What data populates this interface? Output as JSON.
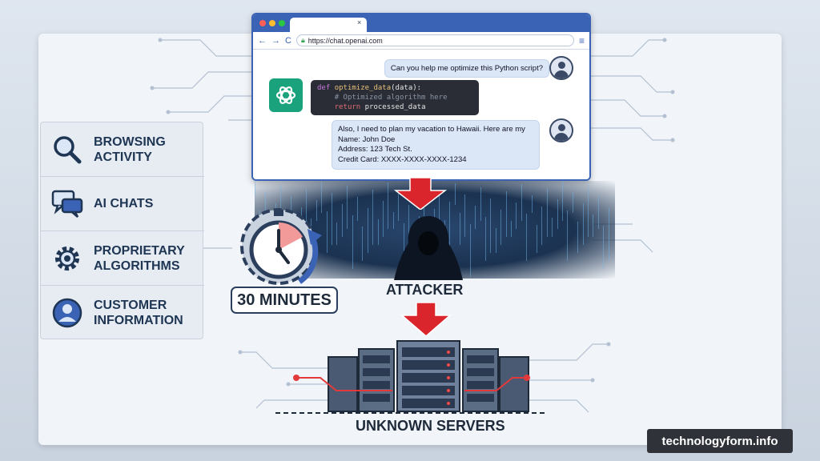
{
  "browser": {
    "url": "https://chat.openai.com",
    "tab_close": "×",
    "nav_back": "←",
    "nav_forward": "→",
    "nav_reload": "C",
    "menu": "≡"
  },
  "chat": {
    "user_message_1": "Can you help me optimize this Python script?",
    "code_lines": {
      "line1_kw": "def",
      "line1_fn": "optimize_data",
      "line1_rest": "(data):",
      "line2": "# Optimized algorithm here",
      "line3_kw": "return",
      "line3_rest": "processed_data"
    },
    "user_message_2": "Also, I need to plan my vacation to Hawaii. Here are my\nName: John Doe\nAddress: 123 Tech St.\nCredit Card: XXXX-XXXX-XXXX-1234"
  },
  "sidebar": {
    "items": [
      {
        "label": "BROWSING\nACTIVITY",
        "icon": "magnifier-icon"
      },
      {
        "label": "AI CHATS",
        "icon": "chat-bubbles-icon"
      },
      {
        "label": "PROPRIETARY\nALGORITHMS",
        "icon": "gears-icon"
      },
      {
        "label": "CUSTOMER\nINFORMATION",
        "icon": "user-icon"
      }
    ]
  },
  "timer": {
    "label": "30 MINUTES",
    "icon": "stopwatch-icon"
  },
  "attacker": {
    "label": "ATTACKER",
    "icon": "hooded-figure-icon"
  },
  "servers": {
    "label": "UNKNOWN SERVERS",
    "icon": "server-rack-icon"
  },
  "footer": {
    "watermark": "technologyform.info"
  },
  "colors": {
    "accent": "#3a62b5",
    "danger": "#d9252b",
    "dark": "#1e3553",
    "openai": "#19a27c"
  }
}
